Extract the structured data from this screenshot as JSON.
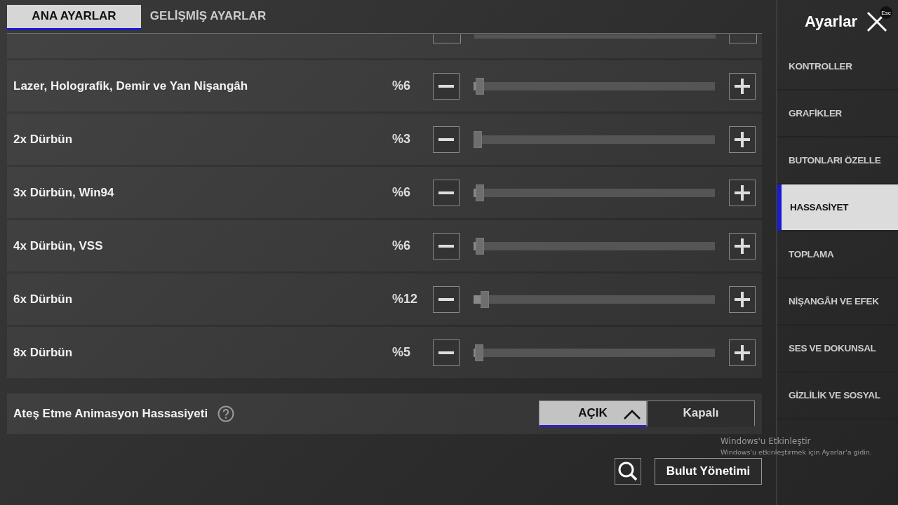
{
  "tabs": [
    {
      "label": "ANA AYARLAR",
      "selected": true
    },
    {
      "label": "GELİŞMİŞ AYARLAR",
      "selected": false
    }
  ],
  "header": {
    "title": "Ayarlar",
    "close_key": "Esc"
  },
  "sliders": [
    {
      "label": "Lazer, Holografik, Demir ve Yan Nişangâh",
      "reading": "%6",
      "level": 0.01
    },
    {
      "label": "2x Dürbün",
      "reading": "%3",
      "level": 0.0
    },
    {
      "label": "3x Dürbün, Win94",
      "reading": "%6",
      "level": 0.01
    },
    {
      "label": "4x Dürbün, VSS",
      "reading": "%6",
      "level": 0.01
    },
    {
      "label": "6x Dürbün",
      "reading": "%12",
      "level": 0.03
    },
    {
      "label": "8x Dürbün",
      "reading": "%5",
      "level": 0.007
    }
  ],
  "fire_animation": {
    "label": "Ateş Etme Animasyon Hassasiyeti",
    "options": [
      {
        "label": "AÇIK",
        "selected": true
      },
      {
        "label": "Kapalı",
        "selected": false
      }
    ]
  },
  "cloud_button": "Bulut Yönetimi",
  "sidebar": {
    "items": [
      {
        "label": "KONTROLLER",
        "selected": false
      },
      {
        "label": "GRAFİKLER",
        "selected": false
      },
      {
        "label": "BUTONLARI ÖZELLE",
        "selected": false
      },
      {
        "label": "HASSASİYET",
        "selected": true
      },
      {
        "label": "TOPLAMA",
        "selected": false
      },
      {
        "label": "NİŞANGÂH VE EFEK",
        "selected": false
      },
      {
        "label": "SES VE DOKUNSAL",
        "selected": false
      },
      {
        "label": "GİZLİLİK VE SOSYAL",
        "selected": false
      }
    ]
  },
  "windows_notice": {
    "title": "Windows'u Etkinleştir",
    "text": "Windows'u etkinleştirmek için Ayarlar'a gidin."
  }
}
